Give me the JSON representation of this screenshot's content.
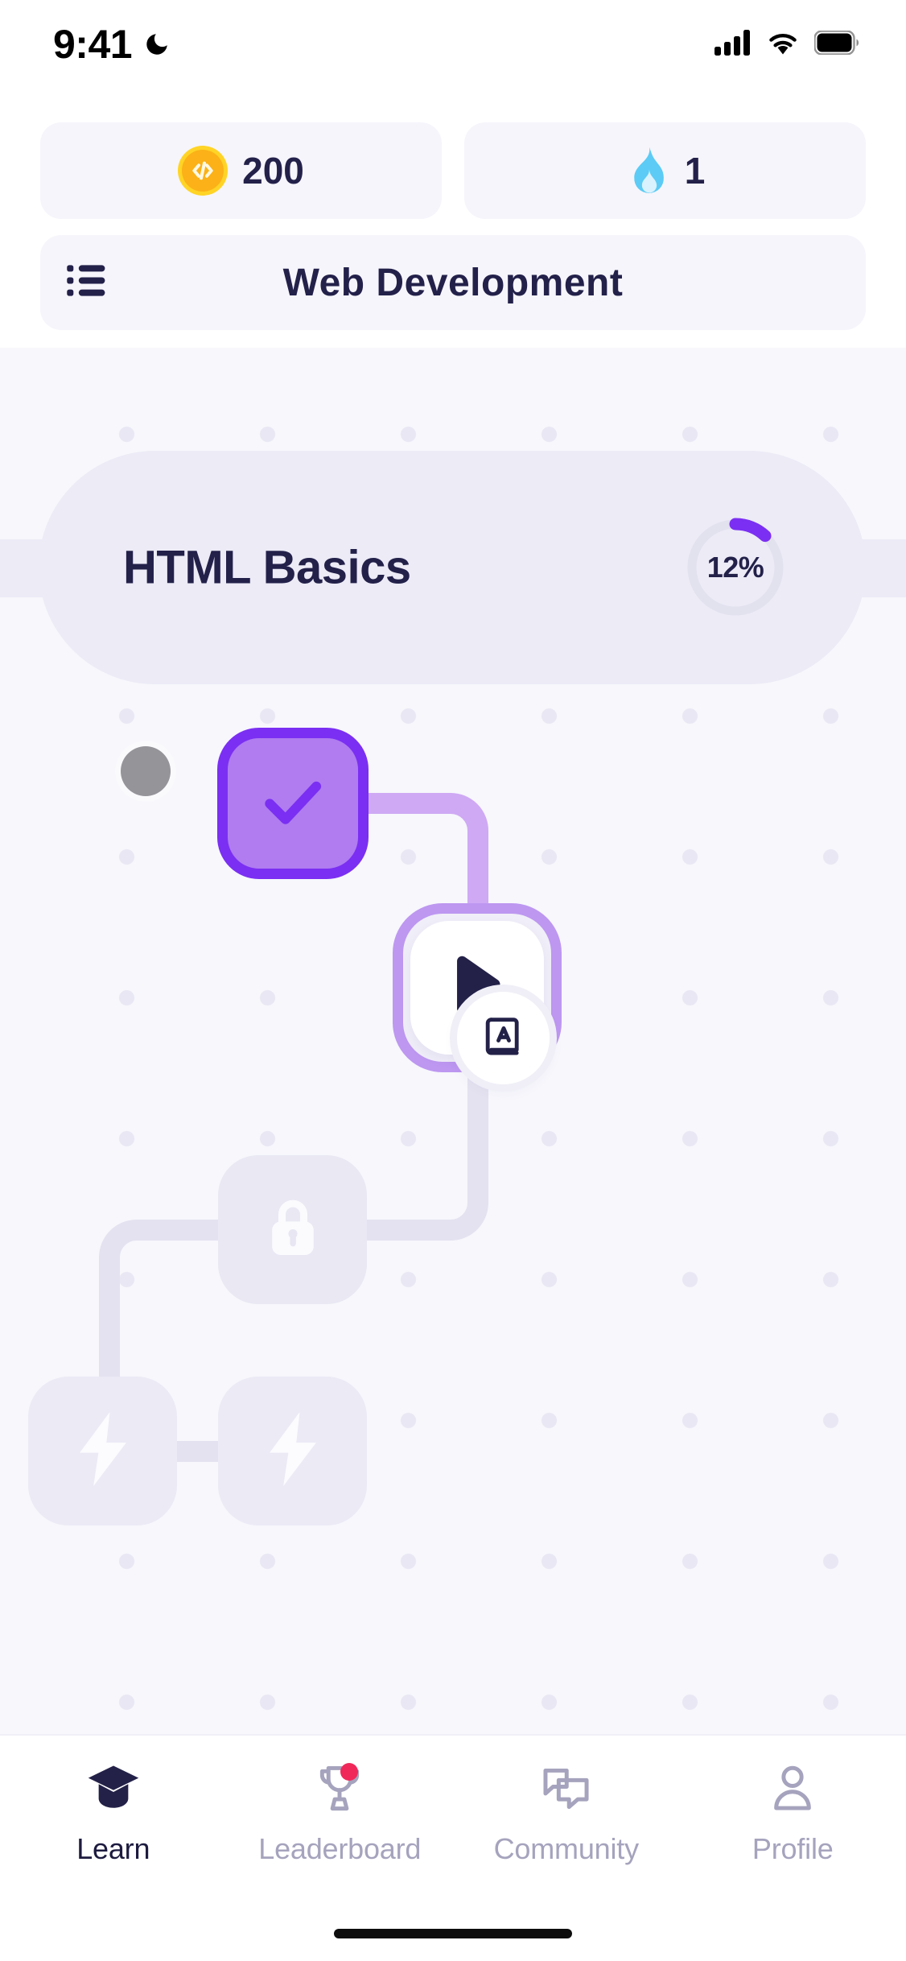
{
  "status_bar": {
    "time": "9:41",
    "dnd_icon": "moon-icon",
    "signal_icon": "cellular-signal-icon",
    "wifi_icon": "wifi-icon",
    "battery_icon": "battery-full-icon"
  },
  "top_stats": [
    {
      "icon": "code-coin-icon",
      "value": "200",
      "name": "coins"
    },
    {
      "icon": "flame-icon",
      "value": "1",
      "name": "streak"
    }
  ],
  "course_header": {
    "menu_icon": "list-menu-icon",
    "title": "Web Development"
  },
  "unit": {
    "name": "HTML Basics",
    "progress_label": "12%",
    "progress_percent": 12,
    "ring_track_color": "#e0dfee",
    "ring_fill_color": "#7b2ff2"
  },
  "lesson_nodes": [
    {
      "name": "lesson-node-completed",
      "state": "completed",
      "icon": "check-icon"
    },
    {
      "name": "lesson-node-current",
      "state": "current",
      "icon": "play-icon"
    },
    {
      "name": "lesson-node-locked",
      "state": "locked",
      "icon": "lock-icon"
    },
    {
      "name": "lesson-node-bolt-left",
      "state": "locked",
      "icon": "bolt-icon"
    },
    {
      "name": "lesson-node-bolt-right",
      "state": "locked",
      "icon": "bolt-icon"
    }
  ],
  "avatar": {
    "name": "user-avatar",
    "color": "#949499"
  },
  "dictionary_fab": {
    "icon": "dictionary-book-icon"
  },
  "bottom_nav": {
    "active": "Learn",
    "items": [
      {
        "label": "Learn",
        "icon": "graduation-cap-icon",
        "active": true,
        "badge": false
      },
      {
        "label": "Leaderboard",
        "icon": "trophy-icon",
        "active": false,
        "badge": true
      },
      {
        "label": "Community",
        "icon": "chat-bubbles-icon",
        "active": false,
        "badge": false
      },
      {
        "label": "Profile",
        "icon": "person-icon",
        "active": false,
        "badge": false
      }
    ]
  },
  "colors": {
    "accent_purple": "#7b2ff2",
    "node_purple_fill": "#b07cf0",
    "ring_light_purple": "#bd97f0",
    "text_dark": "#23214a",
    "muted": "#a5a3bd",
    "coin_gold": "#fbb117",
    "flame_blue": "#5ccbf5",
    "badge_red": "#f0285a",
    "bg_main": "#f7f7fc",
    "bg_pill": "#f6f5fb"
  }
}
